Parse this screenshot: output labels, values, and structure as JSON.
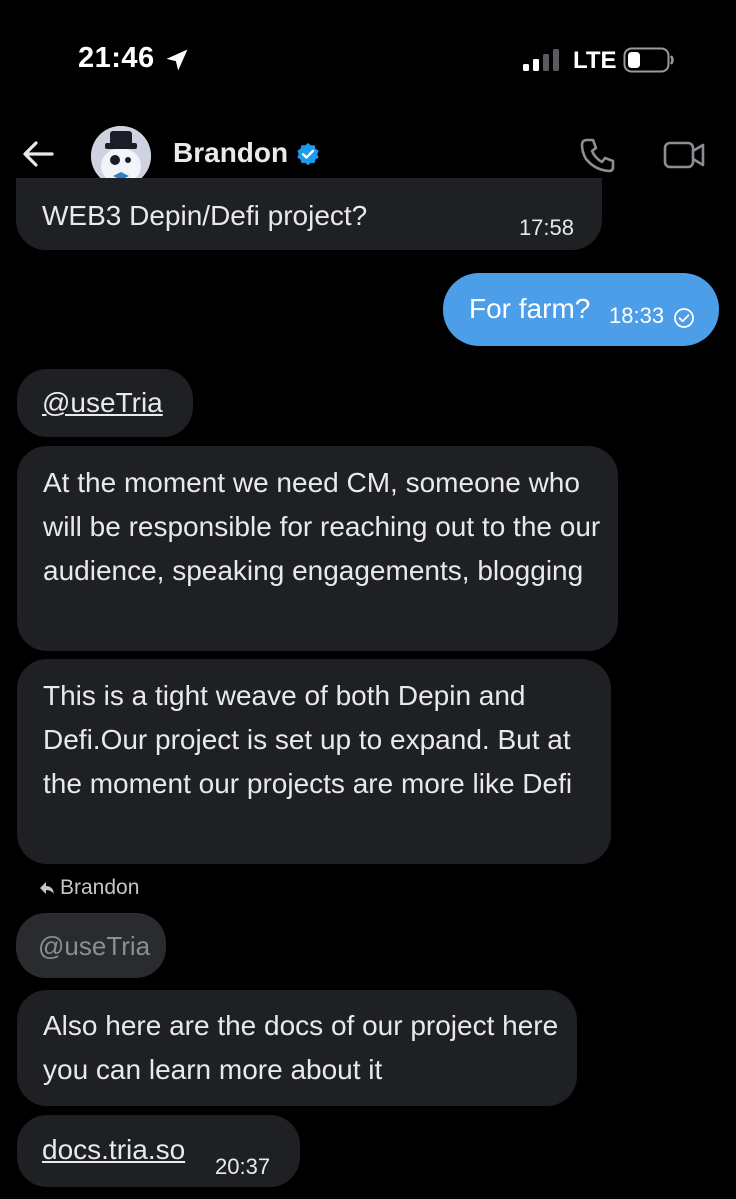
{
  "status_bar": {
    "time": "21:46",
    "network": "LTE"
  },
  "header": {
    "contact_name": "Brandon",
    "verified": true
  },
  "icons": {
    "back": "back-arrow-icon",
    "location": "location-arrow-icon",
    "phone": "phone-icon",
    "video": "video-camera-icon",
    "verified": "verified-badge-icon",
    "reply": "reply-arrow-icon",
    "read": "read-check-icon"
  },
  "colors": {
    "background": "#000000",
    "incoming_bubble": "#1f2023",
    "outgoing_bubble": "#4c9ee8",
    "verified": "#1d9bf0"
  },
  "messages": [
    {
      "direction": "incoming",
      "text": "WEB3 Depin/Defi project?",
      "time": "17:58"
    },
    {
      "direction": "outgoing",
      "text": "For farm?",
      "time": "18:33",
      "status": "read"
    },
    {
      "direction": "incoming",
      "text": "@useTria"
    },
    {
      "direction": "incoming",
      "text": "At the moment we need CM, someone who will be responsible for reaching out to the our  audience, speaking engagements, blogging"
    },
    {
      "direction": "incoming",
      "text": "This is a tight weave of both Depin and Defi.Our project is set up to expand. But at the  moment our projects are more like Defi"
    },
    {
      "direction": "incoming",
      "reply_to": "Brandon",
      "quoted_text": "@useTria",
      "text": "Also here are the docs of our project here you can learn more about it"
    },
    {
      "direction": "incoming",
      "text": "docs.tria.so",
      "time": "20:37"
    }
  ]
}
